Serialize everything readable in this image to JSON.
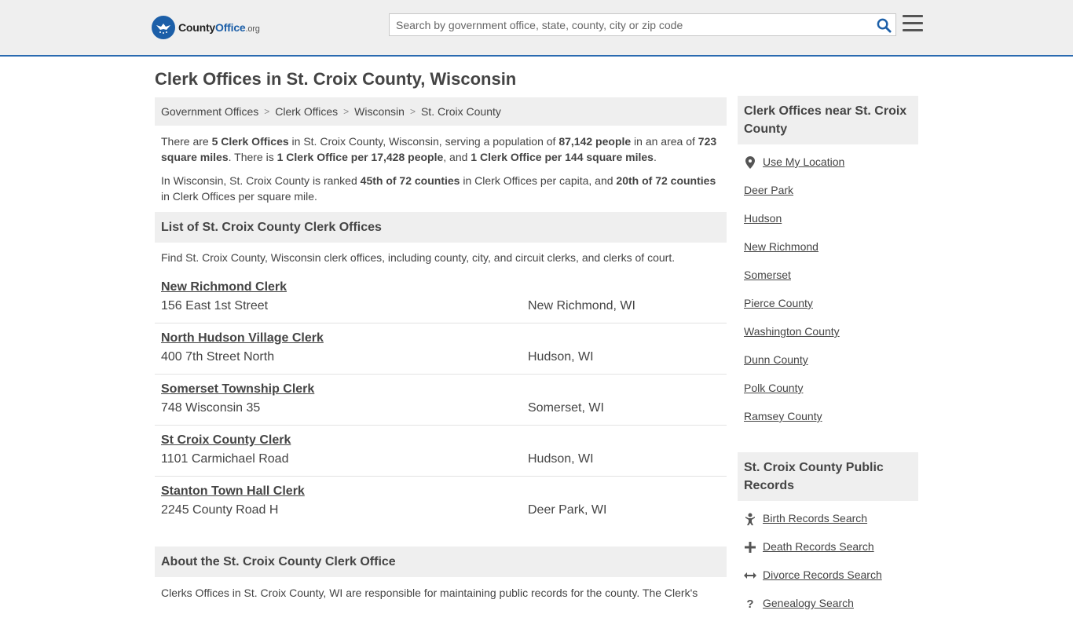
{
  "header": {
    "logo": {
      "name_part1": "County",
      "name_part2": "Office",
      "tld": ".org"
    },
    "search": {
      "placeholder": "Search by government office, state, county, city or zip code",
      "value": ""
    }
  },
  "page": {
    "title": "Clerk Offices in St. Croix County, Wisconsin"
  },
  "breadcrumb": [
    {
      "label": "Government Offices"
    },
    {
      "label": "Clerk Offices"
    },
    {
      "label": "Wisconsin"
    },
    {
      "label": "St. Croix County"
    }
  ],
  "intro": {
    "p1": {
      "t1": "There are ",
      "b1": "5 Clerk Offices",
      "t2": " in St. Croix County, Wisconsin, serving a population of ",
      "b2": "87,142 people",
      "t3": " in an area of ",
      "b3": "723 square miles",
      "t4": ". There is ",
      "b4": "1 Clerk Office per 17,428 people",
      "t5": ", and ",
      "b5": "1 Clerk Office per 144 square miles",
      "t6": "."
    },
    "p2": {
      "t1": "In Wisconsin, St. Croix County is ranked ",
      "b1": "45th of 72 counties",
      "t2": " in Clerk Offices per capita, and ",
      "b2": "20th of 72 counties",
      "t3": " in Clerk Offices per square mile."
    }
  },
  "list_section": {
    "title": "List of St. Croix County Clerk Offices",
    "description": "Find St. Croix County, Wisconsin clerk offices, including county, city, and circuit clerks, and clerks of court.",
    "offices": [
      {
        "name": "New Richmond Clerk",
        "address": "156 East 1st Street",
        "city": "New Richmond, WI"
      },
      {
        "name": "North Hudson Village Clerk",
        "address": "400 7th Street North",
        "city": "Hudson, WI"
      },
      {
        "name": "Somerset Township Clerk",
        "address": "748 Wisconsin 35",
        "city": "Somerset, WI"
      },
      {
        "name": "St Croix County Clerk",
        "address": "1101 Carmichael Road",
        "city": "Hudson, WI"
      },
      {
        "name": "Stanton Town Hall Clerk",
        "address": "2245 County Road H",
        "city": "Deer Park, WI"
      }
    ]
  },
  "about": {
    "title": "About the St. Croix County Clerk Office",
    "text": "Clerks Offices in St. Croix County, WI are responsible for maintaining public records for the county. The Clerk's"
  },
  "sidebar": {
    "nearby": {
      "title": "Clerk Offices near St. Croix County",
      "use_location": "Use My Location",
      "links": [
        "Deer Park",
        "Hudson",
        "New Richmond",
        "Somerset",
        "Pierce County",
        "Washington County",
        "Dunn County",
        "Polk County",
        "Ramsey County"
      ]
    },
    "records": {
      "title": "St. Croix County Public Records",
      "links": [
        {
          "label": "Birth Records Search",
          "icon": "baby-icon"
        },
        {
          "label": "Death Records Search",
          "icon": "cross-icon"
        },
        {
          "label": "Divorce Records Search",
          "icon": "split-arrow-icon"
        },
        {
          "label": "Genealogy Search",
          "icon": "question-icon"
        }
      ]
    }
  },
  "colors": {
    "accent": "#1c5fa8",
    "header_bg": "#efefef",
    "text": "#444444"
  }
}
